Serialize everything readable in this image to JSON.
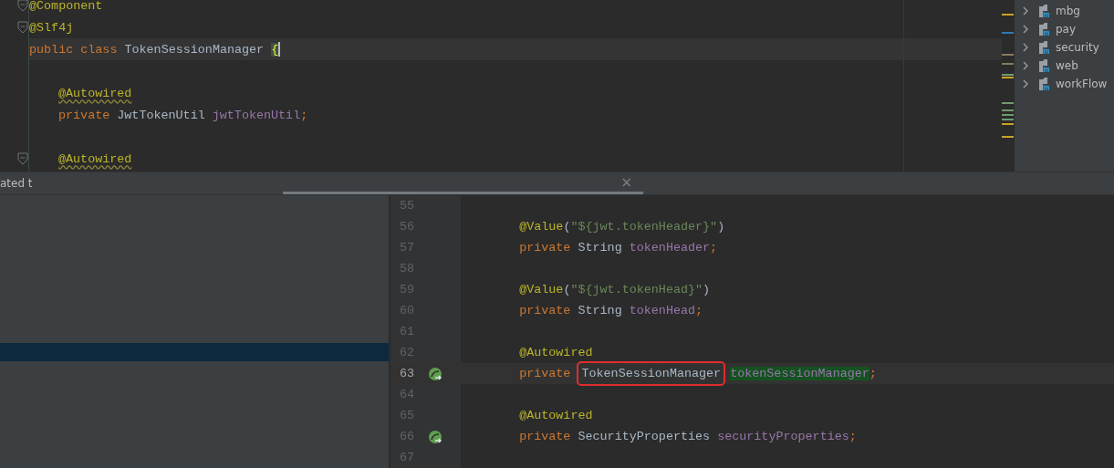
{
  "top_editor": {
    "lines": [
      {
        "fold": true,
        "current": false,
        "indent": false,
        "tokens": [
          {
            "kind": "annotation",
            "text": "@Component"
          }
        ]
      },
      {
        "fold": true,
        "current": false,
        "indent": false,
        "tokens": [
          {
            "kind": "annotation",
            "text": "@Slf4j"
          }
        ]
      },
      {
        "fold": false,
        "current": true,
        "indent": false,
        "tokens": [
          {
            "kind": "keyword",
            "text": "public class "
          },
          {
            "kind": "type",
            "text": "TokenSessionManager "
          },
          {
            "kind": "brace",
            "text": "{"
          }
        ]
      },
      {
        "fold": false,
        "current": false
      },
      {
        "fold": false,
        "current": false,
        "indent": true,
        "tokens": [
          {
            "kind": "annotation",
            "text": "@Autowired",
            "warning": true
          }
        ]
      },
      {
        "fold": false,
        "current": false,
        "indent": true,
        "tokens": [
          {
            "kind": "keyword",
            "text": "private "
          },
          {
            "kind": "type",
            "text": "JwtTokenUtil "
          },
          {
            "kind": "field",
            "text": "jwtTokenUtil"
          },
          {
            "kind": "punct",
            "text": ";"
          }
        ]
      },
      {
        "fold": false,
        "current": false
      },
      {
        "fold": true,
        "current": false,
        "indent": true,
        "tokens": [
          {
            "kind": "annotation",
            "text": "@Autowired",
            "warning": true
          }
        ]
      }
    ]
  },
  "project_tree": {
    "items": [
      {
        "label": "mbg",
        "expanded": false
      },
      {
        "label": "pay",
        "expanded": false
      },
      {
        "label": "security",
        "expanded": false
      },
      {
        "label": "web",
        "expanded": false
      },
      {
        "label": "workFlow",
        "expanded": false
      }
    ]
  },
  "bottom_tabs": {
    "left_text": "ated t",
    "tab": {
      "selected": true,
      "close": "×"
    }
  },
  "left_panel": {
    "rows": [
      {
        "selected": false
      },
      {
        "selected": false
      },
      {
        "selected": false
      },
      {
        "selected": false
      },
      {
        "selected": false
      },
      {
        "selected": false
      },
      {
        "selected": false
      },
      {
        "selected": false
      },
      {
        "selected": true
      },
      {
        "selected": false
      },
      {
        "selected": false
      },
      {
        "selected": false
      },
      {
        "selected": false
      }
    ]
  },
  "bottom_editor": {
    "lines": [
      {
        "number": "55",
        "current": false,
        "gutter_icon": false
      },
      {
        "number": "56",
        "current": false,
        "gutter_icon": false,
        "tokens": [
          {
            "kind": "annotation",
            "text": "@Value"
          },
          {
            "kind": "plain",
            "text": "("
          },
          {
            "kind": "string",
            "text": "\"${jwt.tokenHeader}\""
          },
          {
            "kind": "plain",
            "text": ")"
          }
        ]
      },
      {
        "number": "57",
        "current": false,
        "gutter_icon": false,
        "tokens": [
          {
            "kind": "keyword",
            "text": "private "
          },
          {
            "kind": "type",
            "text": "String "
          },
          {
            "kind": "field",
            "text": "tokenHeader"
          },
          {
            "kind": "punct",
            "text": ";"
          }
        ]
      },
      {
        "number": "58",
        "current": false,
        "gutter_icon": false
      },
      {
        "number": "59",
        "current": false,
        "gutter_icon": false,
        "tokens": [
          {
            "kind": "annotation",
            "text": "@Value"
          },
          {
            "kind": "plain",
            "text": "("
          },
          {
            "kind": "string",
            "text": "\"${jwt.tokenHead}\""
          },
          {
            "kind": "plain",
            "text": ")"
          }
        ]
      },
      {
        "number": "60",
        "current": false,
        "gutter_icon": false,
        "tokens": [
          {
            "kind": "keyword",
            "text": "private "
          },
          {
            "kind": "type",
            "text": "String "
          },
          {
            "kind": "field",
            "text": "tokenHead"
          },
          {
            "kind": "punct",
            "text": ";"
          }
        ]
      },
      {
        "number": "61",
        "current": false,
        "gutter_icon": false
      },
      {
        "number": "62",
        "current": false,
        "gutter_icon": false,
        "tokens": [
          {
            "kind": "annotation",
            "text": "@Autowired"
          }
        ]
      },
      {
        "number": "63",
        "current": true,
        "gutter_icon": true,
        "tokens": [
          {
            "kind": "keyword",
            "text": "private "
          },
          {
            "kind": "type",
            "text": "TokenSessionManager",
            "boxed": true
          },
          {
            "kind": "field",
            "text": "tokenSessionManager",
            "highlight": true
          },
          {
            "kind": "punct",
            "text": ";"
          }
        ]
      },
      {
        "number": "64",
        "current": false,
        "gutter_icon": false
      },
      {
        "number": "65",
        "current": false,
        "gutter_icon": false,
        "tokens": [
          {
            "kind": "annotation",
            "text": "@Autowired"
          }
        ]
      },
      {
        "number": "66",
        "current": false,
        "gutter_icon": true,
        "tokens": [
          {
            "kind": "keyword",
            "text": "private "
          },
          {
            "kind": "type",
            "text": "SecurityProperties "
          },
          {
            "kind": "field",
            "text": "securityProperties"
          },
          {
            "kind": "punct",
            "text": ";"
          }
        ]
      },
      {
        "number": "67",
        "current": false,
        "gutter_icon": false
      }
    ]
  }
}
